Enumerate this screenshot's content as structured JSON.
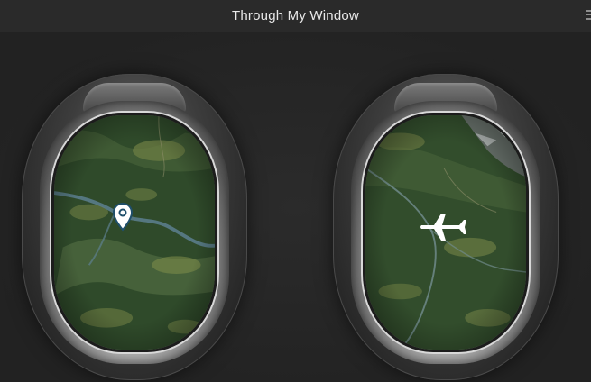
{
  "app": {
    "title": "Through My Window"
  },
  "windows": [
    {
      "name": "left-window",
      "overlay": "location-pin-icon"
    },
    {
      "name": "right-window",
      "overlay": "airplane-icon"
    }
  ],
  "colors": {
    "background": "#252525",
    "title_text": "#e9e9e9",
    "pin_fill": "#ffffff",
    "pin_stroke": "#1f4f6b",
    "terrain_forest": "#2f4f2c",
    "terrain_field": "#6f7f44",
    "river": "#5c7f8f"
  }
}
